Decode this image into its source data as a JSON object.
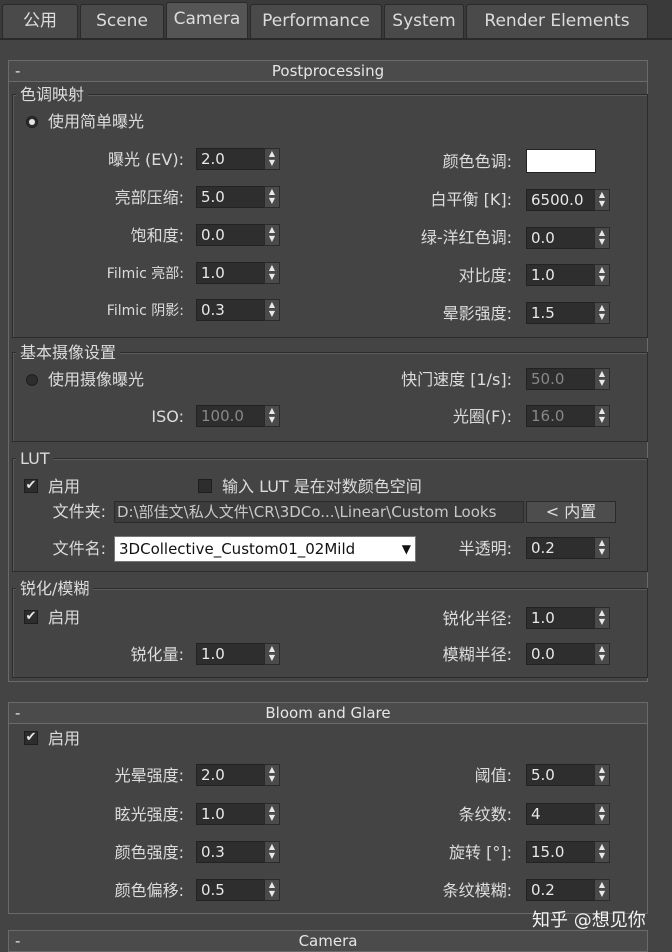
{
  "tabs": [
    "公用",
    "Scene",
    "Camera",
    "Performance",
    "System",
    "Render Elements"
  ],
  "active_tab": "Camera",
  "postprocessing": {
    "title": "Postprocessing",
    "collapse_symbol": "-",
    "tone_mapping": {
      "title": "色调映射",
      "simple_exposure_label": "使用简单曝光",
      "exposure_label": "曝光 (EV):",
      "exposure_value": "2.0",
      "highlight_compression_label": "亮部压缩:",
      "highlight_compression_value": "5.0",
      "saturation_label": "饱和度:",
      "saturation_value": "0.0",
      "filmic_highlights_label": "Filmic 亮部:",
      "filmic_highlights_value": "1.0",
      "filmic_shadows_label": "Filmic 阴影:",
      "filmic_shadows_value": "0.3",
      "color_tint_label": "颜色色调:",
      "color_tint_color": "#ffffff",
      "white_balance_label": "白平衡 [K]:",
      "white_balance_value": "6500.0",
      "green_magenta_label": "绿-洋红色调:",
      "green_magenta_value": "0.0",
      "contrast_label": "对比度:",
      "contrast_value": "1.0",
      "vignetting_label": "晕影强度:",
      "vignetting_value": "1.5"
    },
    "physical_camera": {
      "title": "基本摄像设置",
      "use_camera_exposure_label": "使用摄像曝光",
      "shutter_speed_label": "快门速度 [1/s]:",
      "shutter_speed_value": "50.0",
      "iso_label": "ISO:",
      "iso_value": "100.0",
      "aperture_label": "光圈(F):",
      "aperture_value": "16.0"
    },
    "lut": {
      "title": "LUT",
      "enable_label": "启用",
      "log_space_label": "输入 LUT 是在对数颜色空间",
      "folder_label": "文件夹:",
      "folder_path": "D:\\部佳文\\私人文件\\CR\\3DCo...\\Linear\\Custom Looks",
      "builtin_label": "< 内置",
      "filename_label": "文件名:",
      "filename_value": "3DCollective_Custom01_02Mild",
      "opacity_label": "半透明:",
      "opacity_value": "0.2"
    },
    "sharpen": {
      "title": "锐化/模糊",
      "enable_label": "启用",
      "sharpen_radius_label": "锐化半径:",
      "sharpen_radius_value": "1.0",
      "sharpen_amount_label": "锐化量:",
      "sharpen_amount_value": "1.0",
      "blur_radius_label": "模糊半径:",
      "blur_radius_value": "0.0"
    }
  },
  "bloom": {
    "title": "Bloom and Glare",
    "collapse_symbol": "-",
    "enable_label": "启用",
    "bloom_intensity_label": "光晕强度:",
    "bloom_intensity_value": "2.0",
    "glare_intensity_label": "眩光强度:",
    "glare_intensity_value": "1.0",
    "color_intensity_label": "颜色强度:",
    "color_intensity_value": "0.3",
    "color_shift_label": "颜色偏移:",
    "color_shift_value": "0.5",
    "threshold_label": "阈值:",
    "threshold_value": "5.0",
    "streaks_label": "条纹数:",
    "streaks_value": "4",
    "rotation_label": "旋转 [°]:",
    "rotation_value": "15.0",
    "streak_blur_label": "条纹模糊:",
    "streak_blur_value": "0.2"
  },
  "camera_rollout": {
    "title": "Camera",
    "collapse_symbol": "-"
  },
  "watermark": "知乎 @想见你",
  "arrows": {
    "up": "▲",
    "down": "▼"
  },
  "check_mark": "✔"
}
